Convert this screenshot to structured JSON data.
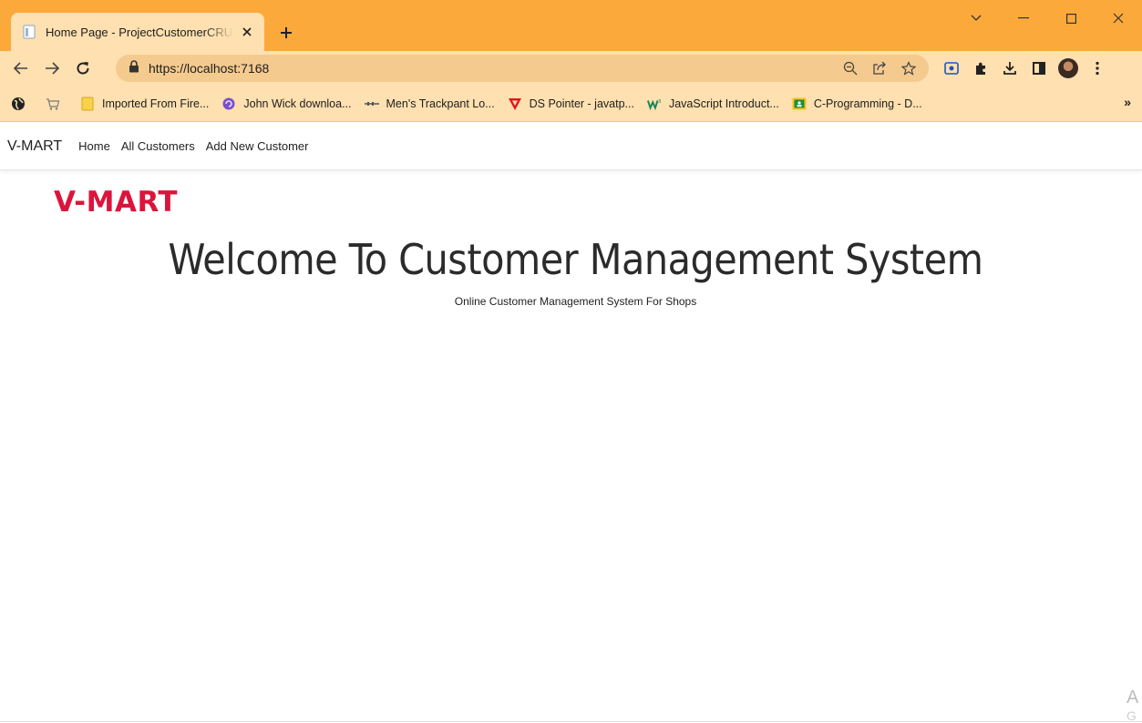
{
  "browser": {
    "tab": {
      "title": "Home Page - ProjectCustomerCRUD"
    },
    "address": {
      "url": "https://localhost:7168"
    },
    "bookmarks": [
      {
        "label": "",
        "icon": "globe-icon"
      },
      {
        "label": "",
        "icon": "cart-icon"
      },
      {
        "label": "Imported From Fire...",
        "icon": "folder-icon"
      },
      {
        "label": "John Wick downloa...",
        "icon": "swirl-icon"
      },
      {
        "label": "Men's Trackpant Lo...",
        "icon": "dash-icon"
      },
      {
        "label": "DS Pointer - javatp...",
        "icon": "triangle-icon"
      },
      {
        "label": "JavaScript Introduct...",
        "icon": "w3-icon"
      },
      {
        "label": "C-Programming - D...",
        "icon": "classroom-icon"
      }
    ],
    "bookmarks_overflow": "»",
    "colors": {
      "frame": "#fca93b",
      "toolbar": "#ffe0b0",
      "omnibox": "#f5ca8e"
    }
  },
  "site": {
    "nav": {
      "brand": "V-MART",
      "links": [
        "Home",
        "All Customers",
        "Add New Customer"
      ]
    },
    "logo": "V-MART",
    "hero": {
      "title": "Welcome To Customer Management System",
      "subtitle": "Online Customer Management System For Shops"
    },
    "watermark": [
      "A",
      "G"
    ],
    "colors": {
      "logo": "#dc143c"
    }
  }
}
